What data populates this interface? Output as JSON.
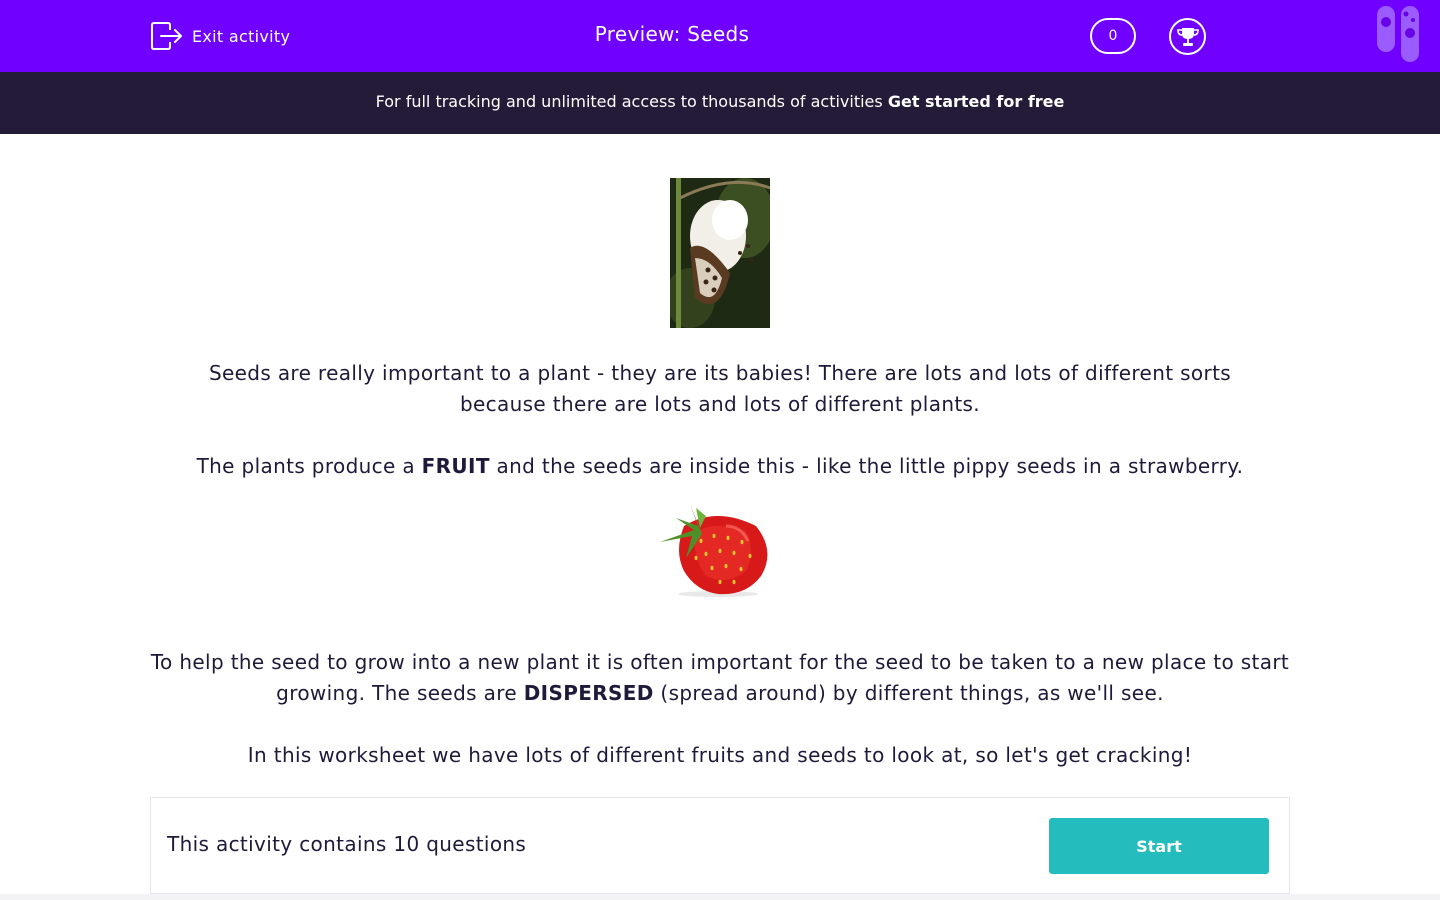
{
  "header": {
    "exit_label": "Exit activity",
    "title": "Preview: Seeds",
    "score": "0",
    "icons": [
      "exit-icon",
      "trophy-icon",
      "edplace-logo-icon"
    ],
    "background_color": "#7000ff"
  },
  "banner": {
    "text": "For full tracking and unlimited access to thousands of activities ",
    "link": "Get started for free",
    "background_color": "#241b38"
  },
  "content": {
    "images": [
      "milkweed-seed-pod-image",
      "strawberry-image"
    ],
    "p1": "Seeds are really important to a plant - they are its babies! There are lots and lots of different sorts because there are lots and lots of different plants.",
    "p2_a": "The plants produce a ",
    "p2_bold": "FRUIT",
    "p2_b": " and the seeds are inside this - like the little pippy seeds in a strawberry.",
    "p3_a": "To help the seed to grow into a new plant it is often important for the seed to be taken to a new place to start growing. The seeds are ",
    "p3_bold": "DISPERSED",
    "p3_b": " (spread around) by different things, as we'll see.",
    "p4": "In this worksheet we have lots of different fruits and seeds to look at, so let's get cracking!"
  },
  "footer": {
    "count_text": "This activity contains 10 questions",
    "start_label": "Start",
    "start_color": "#25bcbd"
  }
}
